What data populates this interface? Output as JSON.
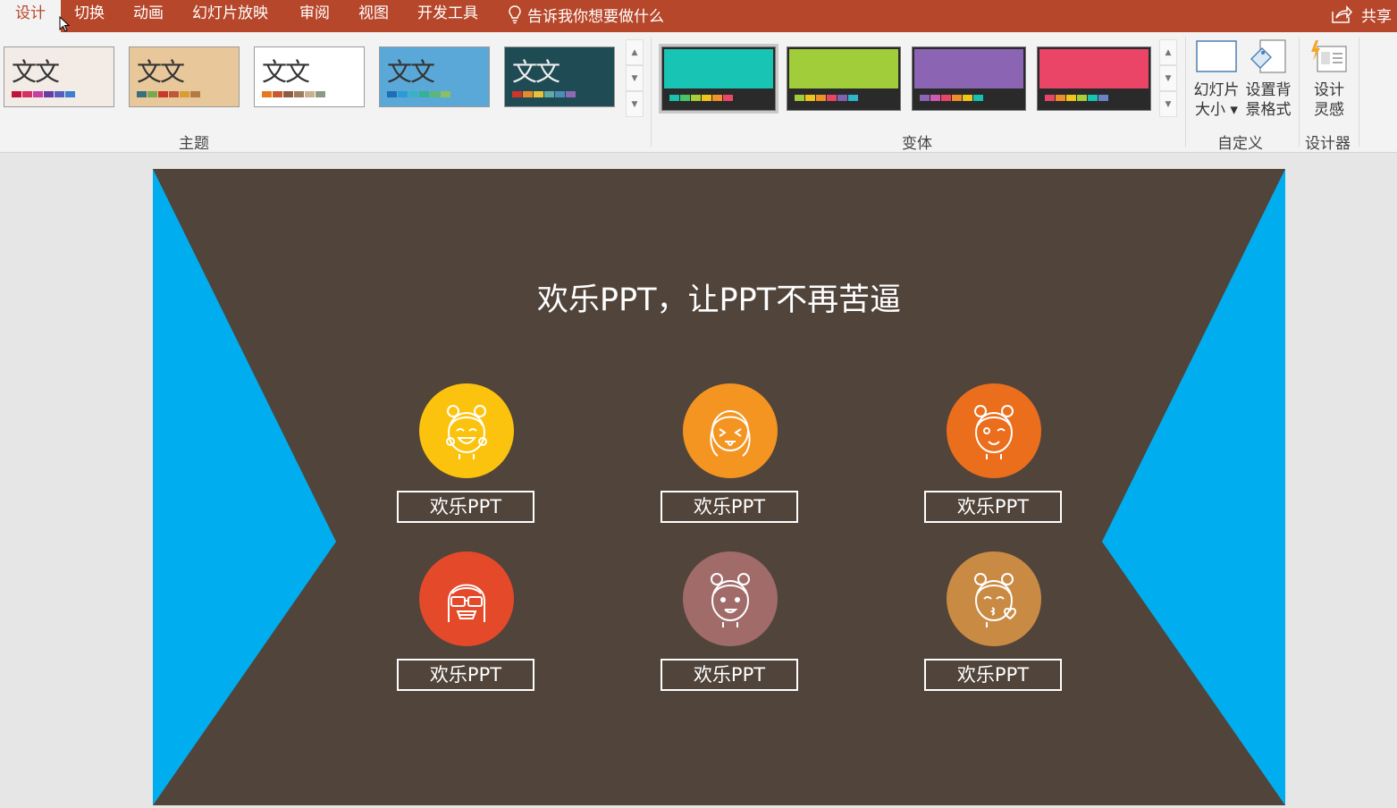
{
  "tabs": [
    {
      "label": "设计",
      "active": true
    },
    {
      "label": "切换"
    },
    {
      "label": "动画"
    },
    {
      "label": "幻灯片放映"
    },
    {
      "label": "审阅"
    },
    {
      "label": "视图"
    },
    {
      "label": "开发工具"
    }
  ],
  "tell_me": "告诉我你想要做什么",
  "share": "共享",
  "themes": {
    "group_label": "主题",
    "thumb_text": "文文",
    "items": [
      {
        "bg": "#f2ebe6",
        "swatches": [
          "#c0143c",
          "#d33064",
          "#c73fa0",
          "#6a3ea0",
          "#5a5fbf",
          "#3f7fd0"
        ]
      },
      {
        "bg": "#e8c89a",
        "swatches": [
          "#3a6e7a",
          "#7aa84a",
          "#c7392a",
          "#c0563c",
          "#d89e35",
          "#b37b43"
        ]
      },
      {
        "bg": "#ffffff",
        "swatches": [
          "#e87722",
          "#c75b2d",
          "#8d5d43",
          "#9d7d5e",
          "#c9b18d",
          "#8c9a85"
        ]
      },
      {
        "bg": "#5aa8d8",
        "swatches": [
          "#1b6fb5",
          "#2c9ad4",
          "#39b1c8",
          "#36b096",
          "#58b779",
          "#8cbf62"
        ]
      },
      {
        "bg": "#1f4b54",
        "swatches": [
          "#d2332a",
          "#e8892c",
          "#e8c13a",
          "#62a8a3",
          "#4a8db9",
          "#8b6bb2"
        ]
      }
    ]
  },
  "variants": {
    "group_label": "变体",
    "items": [
      {
        "color": "#18c4b4",
        "swatches": [
          "#17c1b0",
          "#47c46a",
          "#a7cd38",
          "#f2c419",
          "#f2922a",
          "#ec4766"
        ]
      },
      {
        "color": "#a2cd3b",
        "swatches": [
          "#a2cd3b",
          "#f0c418",
          "#ef8f29",
          "#e84562",
          "#7e63b0",
          "#2fb6c9"
        ]
      },
      {
        "color": "#8b64b4",
        "swatches": [
          "#8b64b4",
          "#d05ab1",
          "#ea4566",
          "#f08d2a",
          "#f2c419",
          "#15c2b2"
        ]
      },
      {
        "color": "#ea4567",
        "swatches": [
          "#ea4567",
          "#f08c2a",
          "#f2c41a",
          "#a4cf3b",
          "#17c3b2",
          "#6b84c8"
        ]
      }
    ]
  },
  "customize": {
    "slide_size": [
      "幻灯片",
      "大小 ▾"
    ],
    "format_bg": [
      "设置背",
      "景格式"
    ],
    "group_label": "自定义"
  },
  "designer": {
    "button": [
      "设计",
      "灵感"
    ],
    "group_label": "设计器"
  },
  "slide": {
    "title": "欢乐PPT，让PPT不再苦逼",
    "items": [
      {
        "label": "欢乐PPT",
        "color": "#fcc30e",
        "icon": "laughing-girl-icon"
      },
      {
        "label": "欢乐PPT",
        "color": "#f49421",
        "icon": "tongue-out-girl-icon"
      },
      {
        "label": "欢乐PPT",
        "color": "#ea6e1c",
        "icon": "winking-girl-icon"
      },
      {
        "label": "欢乐PPT",
        "color": "#e4492a",
        "icon": "sunglasses-girl-icon"
      },
      {
        "label": "欢乐PPT",
        "color": "#a06b69",
        "icon": "smiling-girl-icon"
      },
      {
        "label": "欢乐PPT",
        "color": "#c98a43",
        "icon": "kissing-girl-icon"
      }
    ]
  }
}
